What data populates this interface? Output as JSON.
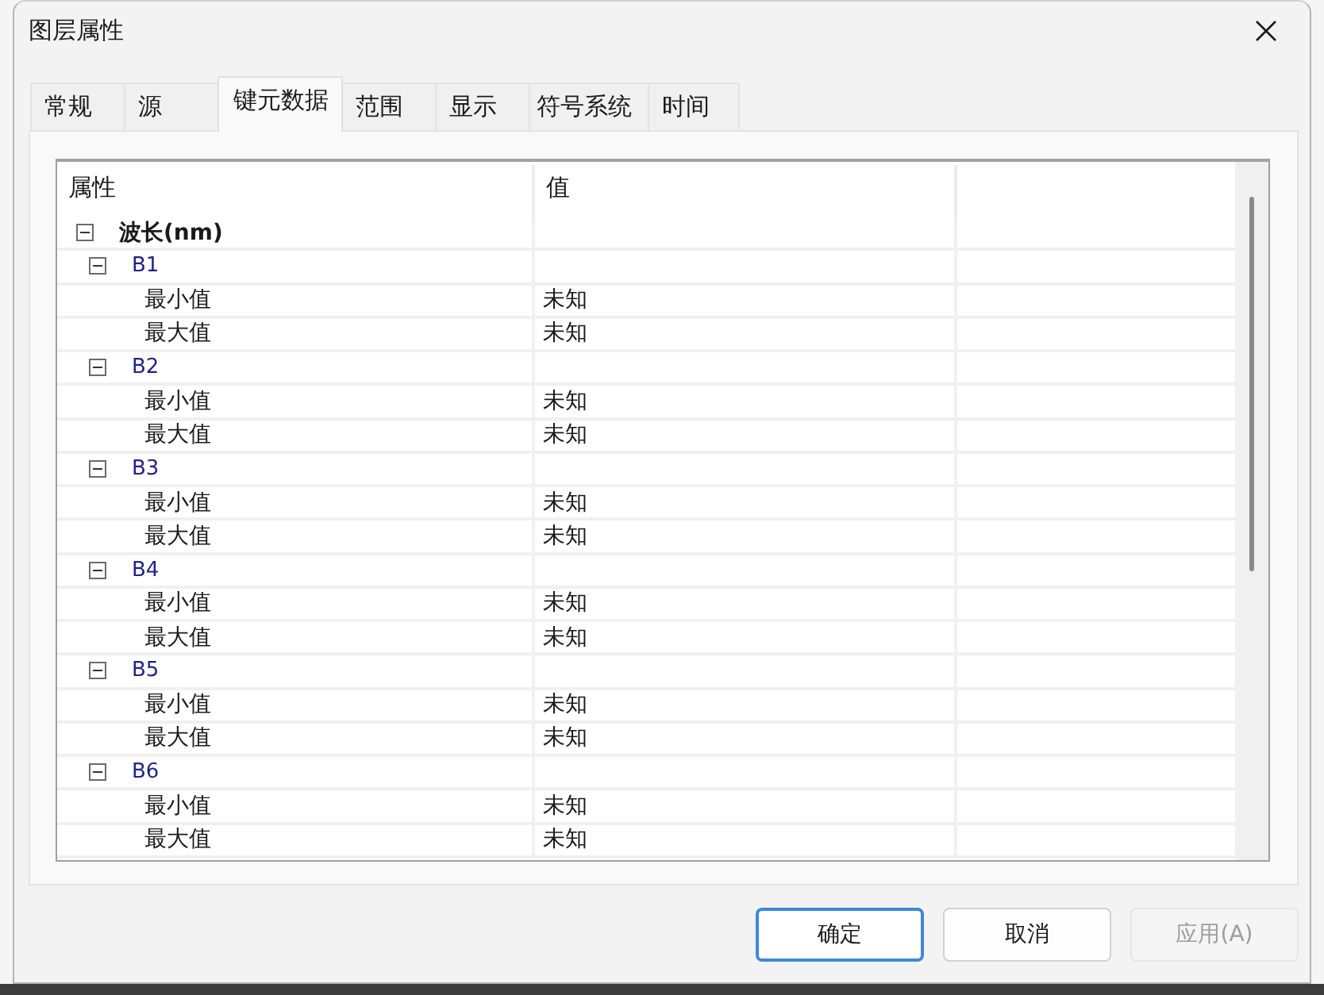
{
  "window": {
    "title": "图层属性"
  },
  "tabs": [
    {
      "label": "常规",
      "selected": false
    },
    {
      "label": "源",
      "selected": false
    },
    {
      "label": "键元数据",
      "selected": true
    },
    {
      "label": "范围",
      "selected": false
    },
    {
      "label": "显示",
      "selected": false
    },
    {
      "label": "符号系统",
      "selected": false
    },
    {
      "label": "时间",
      "selected": false
    }
  ],
  "table": {
    "columns": [
      "属性",
      "值"
    ],
    "tree": [
      {
        "label": "波长(nm)",
        "expanded": true,
        "children": [
          {
            "label": "B1",
            "expanded": true,
            "children": [
              {
                "label": "最小值",
                "value": "未知"
              },
              {
                "label": "最大值",
                "value": "未知"
              }
            ]
          },
          {
            "label": "B2",
            "expanded": true,
            "children": [
              {
                "label": "最小值",
                "value": "未知"
              },
              {
                "label": "最大值",
                "value": "未知"
              }
            ]
          },
          {
            "label": "B3",
            "expanded": true,
            "children": [
              {
                "label": "最小值",
                "value": "未知"
              },
              {
                "label": "最大值",
                "value": "未知"
              }
            ]
          },
          {
            "label": "B4",
            "expanded": true,
            "children": [
              {
                "label": "最小值",
                "value": "未知"
              },
              {
                "label": "最大值",
                "value": "未知"
              }
            ]
          },
          {
            "label": "B5",
            "expanded": true,
            "children": [
              {
                "label": "最小值",
                "value": "未知"
              },
              {
                "label": "最大值",
                "value": "未知"
              }
            ]
          },
          {
            "label": "B6",
            "expanded": true,
            "children": [
              {
                "label": "最小值",
                "value": "未知"
              },
              {
                "label": "最大值",
                "value": "未知"
              }
            ]
          }
        ]
      }
    ]
  },
  "buttons": [
    {
      "label": "确定",
      "focused": true,
      "disabled": false
    },
    {
      "label": "取消",
      "focused": false,
      "disabled": false
    },
    {
      "label": "应用(A)",
      "focused": false,
      "disabled": true
    }
  ]
}
